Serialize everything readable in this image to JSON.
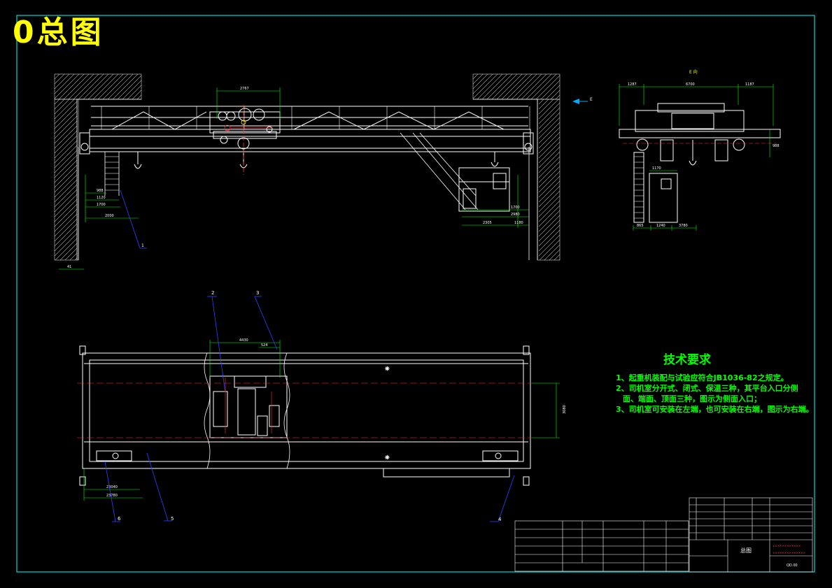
{
  "drawing": {
    "title": "0总图",
    "view_label": "E 向",
    "direction_mark": "E",
    "colors": {
      "background": "#000000",
      "outline": "#ffffff",
      "dimension": "#00ff00",
      "centerline": "#ff3030",
      "title": "#ffff00",
      "leader": "#3040ff",
      "frame": "#00ffff"
    }
  },
  "technical_requirements": {
    "title": "技术要求",
    "items": [
      "1、起重机装配与试验应符合JB1036-82之规定。",
      "2、司机室分开式、闭式、保温三种，其平台入口分侧",
      "面、端面、顶面三种，图示为侧面入口；",
      "3、司机室可安装在左端，也可安装在右端，图示为右端。"
    ]
  },
  "dimensions": {
    "trolley_gauge": "2767",
    "cab_width_1": "1700",
    "cab_width_2": "2980",
    "cab_depth": "2305",
    "cab_offset": "1180",
    "left_a": "1120",
    "left_b": "1700",
    "left_c": "2000",
    "left_d": "988",
    "left_bottom": "41",
    "end_left": "1287",
    "end_mid": "6700",
    "end_right": "1187",
    "end_height": "988",
    "cab_w": "1170",
    "end_bottom_a": "865",
    "end_bottom_b": "1240",
    "end_bottom_c": "3780",
    "plan_span_top": "4430",
    "plan_sub": "524",
    "plan_height": "3080",
    "plan_bottom_a": "23040",
    "plan_bottom_b": "23780"
  },
  "part_callouts": [
    "1",
    "2",
    "3",
    "4",
    "5",
    "6"
  ],
  "title_block": {
    "drawing_name": "总图",
    "drawing_no": "QD.00",
    "company_line_1": "××××××××××××",
    "company_line_2": "××××××××××××××"
  }
}
